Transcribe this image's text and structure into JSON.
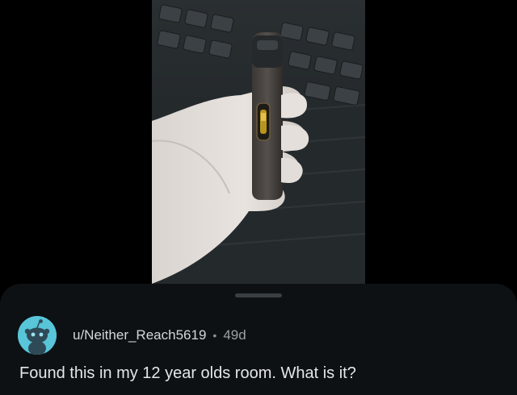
{
  "post": {
    "username": "u/Neither_Reach5619",
    "separator": "•",
    "age": "49d",
    "title": "Found this in my 12 year olds room. What is it?"
  },
  "icons": {
    "avatar": "reddit-snoo-avatar-icon"
  },
  "colors": {
    "sheet_background": "#0d1114",
    "avatar_background": "#58c5d8",
    "username_text": "#d1d7db",
    "body_text": "#e4e7e9"
  }
}
